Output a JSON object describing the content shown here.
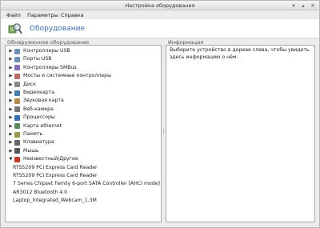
{
  "window": {
    "title": "Настройка оборудования",
    "minimize_glyph": "▾",
    "maximize_glyph": "▴",
    "close_glyph": "✕"
  },
  "menu": [
    "Файл",
    "Параметры",
    "Справка"
  ],
  "header": {
    "title": "Оборудование",
    "icon": "hardware-magnifier-icon",
    "accent": "#3a6fb0"
  },
  "left_panel": {
    "label": "Обнаруженное оборудование"
  },
  "right_panel": {
    "label": "Информация",
    "text": "Выберите устройство в дереве слева, чтобы увидеть здесь информацию о нём."
  },
  "tree": [
    {
      "label": "Контроллеры USB",
      "expanded": false,
      "icon": "usb-icon"
    },
    {
      "label": "Порты USB",
      "expanded": false,
      "icon": "usb-port-icon"
    },
    {
      "label": "Контроллеры SMBus",
      "expanded": false,
      "icon": "chip-icon"
    },
    {
      "label": "Мосты и системные контроллеры",
      "expanded": false,
      "icon": "bridge-icon"
    },
    {
      "label": "Диск",
      "expanded": false,
      "icon": "disk-icon"
    },
    {
      "label": "Видеокарта",
      "expanded": false,
      "icon": "video-card-icon"
    },
    {
      "label": "Звуковая карта",
      "expanded": false,
      "icon": "sound-card-icon"
    },
    {
      "label": "Веб-камера",
      "expanded": false,
      "icon": "webcam-icon"
    },
    {
      "label": "Процессоры",
      "expanded": false,
      "icon": "cpu-icon"
    },
    {
      "label": "Карта ethernet",
      "expanded": false,
      "icon": "ethernet-icon"
    },
    {
      "label": "Память",
      "expanded": false,
      "icon": "memory-icon"
    },
    {
      "label": "Клавиатура",
      "expanded": false,
      "icon": "keyboard-icon"
    },
    {
      "label": "Мышь",
      "expanded": false,
      "icon": "mouse-icon"
    },
    {
      "label": "Неизвестный/Другие",
      "expanded": true,
      "icon": "unknown-device-icon"
    }
  ],
  "unknown_children": [
    "RTS5209 PCI Express Card Reader",
    "RTS5209 PCI Express Card Reader",
    "7 Series Chipset Family 6-port SATA Controller [AHCI mode]",
    "AR3012 Bluetooth 4.0",
    "Laptop_Integrated_Webcam_1.3M"
  ],
  "arrows": {
    "collapsed": "▶",
    "expanded": "▼"
  }
}
